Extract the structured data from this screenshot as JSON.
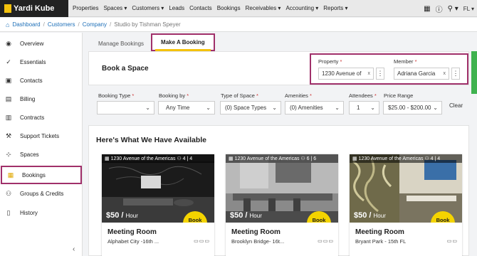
{
  "topnav": {
    "logo": "Yardi",
    "logo_suffix": "Kube",
    "items": [
      "Properties",
      "Spaces ▾",
      "Customers ▾",
      "Leads",
      "Contacts",
      "Bookings",
      "Receivables ▾",
      "Accounting ▾",
      "Reports ▾"
    ],
    "user_initials": "FL ▾"
  },
  "breadcrumb": {
    "home": "Dashboard",
    "customers": "Customers",
    "company": "Company",
    "current": "Studio by Tishman Speyer"
  },
  "sidebar": {
    "items": [
      {
        "label": "Overview",
        "icon": "eye-icon"
      },
      {
        "label": "Essentials",
        "icon": "check-circle-icon"
      },
      {
        "label": "Contacts",
        "icon": "contact-card-icon"
      },
      {
        "label": "Billing",
        "icon": "document-icon"
      },
      {
        "label": "Contracts",
        "icon": "contract-icon"
      },
      {
        "label": "Support Tickets",
        "icon": "wrench-icon"
      },
      {
        "label": "Spaces",
        "icon": "spaces-icon"
      },
      {
        "label": "Bookings",
        "icon": "calendar-icon"
      },
      {
        "label": "Groups & Credits",
        "icon": "group-icon"
      },
      {
        "label": "History",
        "icon": "history-icon"
      }
    ]
  },
  "tabs": {
    "manage": "Manage Bookings",
    "make": "Make A Booking"
  },
  "panel": {
    "title": "Book a Space",
    "property_label": "Property",
    "property_value": "1230 Avenue of",
    "member_label": "Member",
    "member_value": "Adriana Garcia",
    "clear_x": "x",
    "required_mark": "*"
  },
  "filters": {
    "booking_type_label": "Booking Type",
    "booking_type_value": "",
    "booking_by_label": "Booking by",
    "booking_by_value": "Any Time",
    "type_of_space_label": "Type of Space",
    "type_of_space_value": "(0) Space Types",
    "amenities_label": "Amenities",
    "amenities_value": "(0) Amenities",
    "attendees_label": "Attendees",
    "attendees_value": "1",
    "price_range_label": "Price Range",
    "price_range_value": "$25.00 - $200.00",
    "clear": "Clear"
  },
  "results": {
    "title": "Here's What We Have Available",
    "cards": [
      {
        "address": "1230 Avenue of the Americas",
        "capacity": "4 | 4",
        "price": "$50 /",
        "per": "Hour",
        "book": "Book Now",
        "name": "Meeting Room",
        "location": "Alphabet City -16th ..."
      },
      {
        "address": "1230 Avenue of the Americas",
        "capacity": "6 | 6",
        "price": "$50 /",
        "per": "Hour",
        "book": "Book Now",
        "name": "Meeting Room",
        "location": "Brooklyn Bridge- 16t..."
      },
      {
        "address": "1230 Avenue of the Americas",
        "capacity": "4 | 4",
        "price": "$50 /",
        "per": "Hour",
        "book": "Book Now",
        "name": "Meeting Room",
        "location": "Bryant Park - 15th FL"
      }
    ]
  },
  "colors": {
    "highlight": "#a0306a",
    "accent": "#f4c20d",
    "link": "#1d6fb8"
  }
}
